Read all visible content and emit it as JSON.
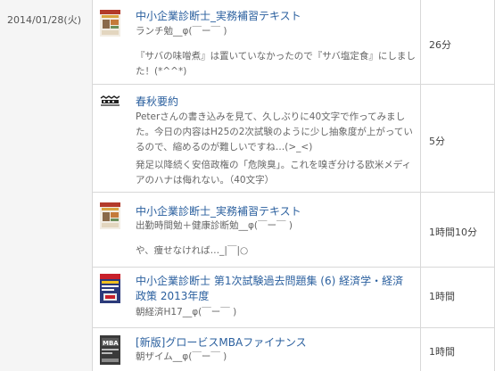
{
  "date": "2014/01/28(火)",
  "entries": [
    {
      "title": "中小企業診断士_実務補習テキスト",
      "sub": "ランチ勉__φ(￣ー￣ )",
      "comment": "『サバの味噌煮』は置いていなかったので『サバ塩定食』にしました！(*^^*)",
      "time": "26分"
    },
    {
      "title": "春秋要約",
      "sub": "",
      "comment": "Peterさんの書き込みを見て、久しぶりに40文字で作ってみました。今日の内容はH25の2次試験のように少し抽象度が上がっているので、縮めるのが難しいですね…(>_<)",
      "comment2": "発足以降続く安倍政権の「危険臭」。これを嗅ぎ分ける欧米メディアのハナは侮れない。（40文字）",
      "time": "5分"
    },
    {
      "title": "中小企業診断士_実務補習テキスト",
      "sub": "出勤時間勉＋健康診断勉__φ(￣ー￣ )",
      "comment": "や、痩せなければ…_|￣|○",
      "time": "1時間10分"
    },
    {
      "title": "中小企業診断士 第1次試験過去問題集 (6) 経済学・経済政策 2013年度",
      "sub": "朝経済H17__φ(￣ー￣ )",
      "comment": "",
      "time": "1時間"
    },
    {
      "title": "[新版]グロービスMBAファイナンス",
      "sub": "朝ザイム__φ(￣ー￣ )",
      "comment": "",
      "time": "1時間"
    }
  ],
  "colors": {
    "link": "#2a5f9e",
    "border": "#d8d8d8",
    "date_bg": "#f5f5f5"
  }
}
